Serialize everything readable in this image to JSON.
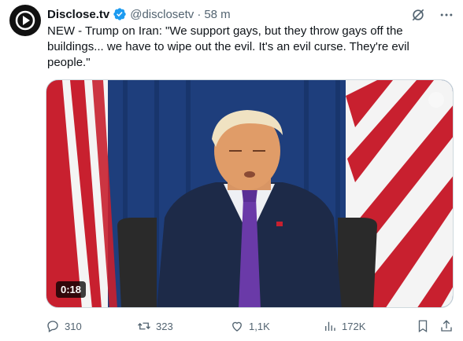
{
  "author": {
    "name": "Disclose.tv",
    "handle": "@disclosetv",
    "separator": "·",
    "time": "58 m"
  },
  "tweet": {
    "text": "NEW - Trump on Iran: \"We support gays, but they throw gays off the buildings... we have to wipe out the evil. It's an evil curse. They're evil people.\""
  },
  "media": {
    "type": "video",
    "duration": "0:18"
  },
  "stats": {
    "replies": "310",
    "reposts": "323",
    "likes": "1,1K",
    "views": "172K"
  },
  "icons": {
    "avatar": "play-logo-icon",
    "verified": "verified-badge-icon",
    "grok": "grok-icon",
    "more": "more-icon",
    "reply": "reply-icon",
    "repost": "repost-icon",
    "like": "heart-icon",
    "views": "views-icon",
    "bookmark": "bookmark-icon",
    "share": "share-icon"
  },
  "colors": {
    "verified": "#1d9bf0",
    "text": "#0f1419",
    "muted": "#536471"
  }
}
